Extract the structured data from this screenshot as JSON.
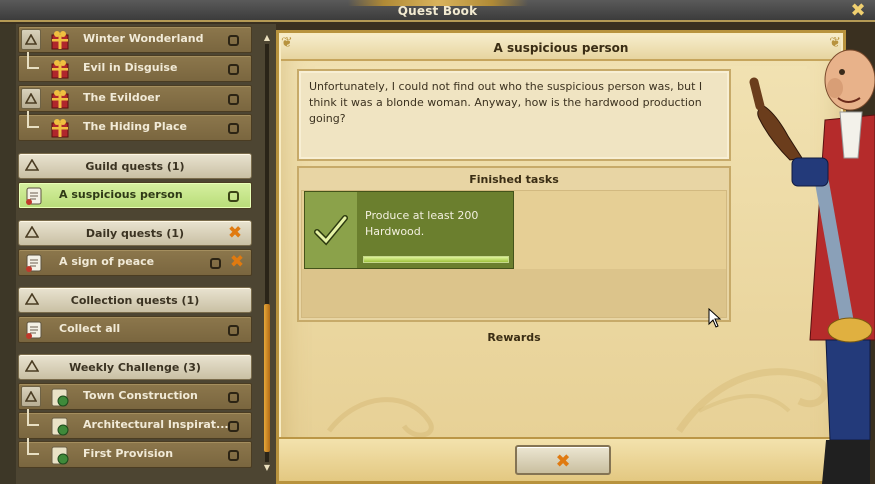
{
  "window": {
    "title": "Quest Book"
  },
  "quest_list": {
    "story_rows": [
      {
        "label": "Winter Wonderland",
        "indent": false
      },
      {
        "label": "Evil in Disguise",
        "indent": true
      },
      {
        "label": "The Evildoer",
        "indent": false
      },
      {
        "label": "The Hiding Place",
        "indent": true
      }
    ],
    "guild": {
      "header": "Guild quests (1)",
      "items": [
        {
          "label": "A suspicious person",
          "active": true
        }
      ]
    },
    "daily": {
      "header": "Daily quests (1)",
      "items": [
        {
          "label": "A sign of peace"
        }
      ]
    },
    "collection": {
      "header": "Collection quests (1)",
      "items": [
        {
          "label": "Collect all"
        }
      ]
    },
    "weekly": {
      "header": "Weekly Challenge (3)",
      "items": [
        {
          "label": "Town Construction",
          "indent": false
        },
        {
          "label": "Architectural Inspirat...",
          "indent": true
        },
        {
          "label": "First Provision",
          "indent": true
        }
      ]
    }
  },
  "quest_detail": {
    "title": "A suspicious person",
    "story": "Unfortunately, I could not find out who the suspicious person was, but I think it was a blonde woman. Anyway, how is the hardwood production going?",
    "finished_tasks_title": "Finished tasks",
    "tasks": [
      {
        "text": "Produce at least 200 Hardwood.",
        "progress": 1.0
      }
    ],
    "rewards_title": "Rewards"
  },
  "buttons": {
    "close_symbol": "✖"
  },
  "colors": {
    "accent_orange": "#e07a10",
    "task_green": "#6b7f2e",
    "active_row": "#c8e68c"
  }
}
